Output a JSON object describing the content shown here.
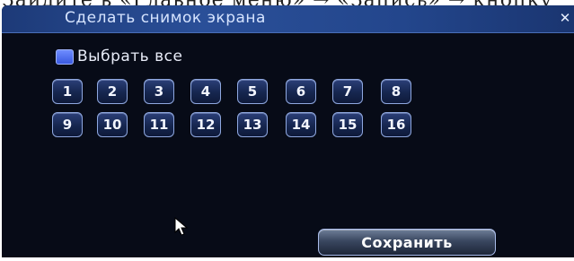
{
  "document_header_fragment": "Зайдите в «Главное меню» → «Запись» → кнопку",
  "window": {
    "title": "Сделать снимок экрана",
    "close_icon": "close-icon"
  },
  "select_all": {
    "label": "Выбрать все",
    "checked": true
  },
  "channels": {
    "row1": [
      "1",
      "2",
      "3",
      "4",
      "5",
      "6",
      "7",
      "8"
    ],
    "row2": [
      "9",
      "10",
      "11",
      "12",
      "13",
      "14",
      "15",
      "16"
    ]
  },
  "save_button": {
    "label": "Сохранить"
  },
  "colors": {
    "panel_bg": "#070b17",
    "titlebar": "#23468c",
    "checkbox": "#4a68f0",
    "button_border": "#8fa8e0"
  }
}
